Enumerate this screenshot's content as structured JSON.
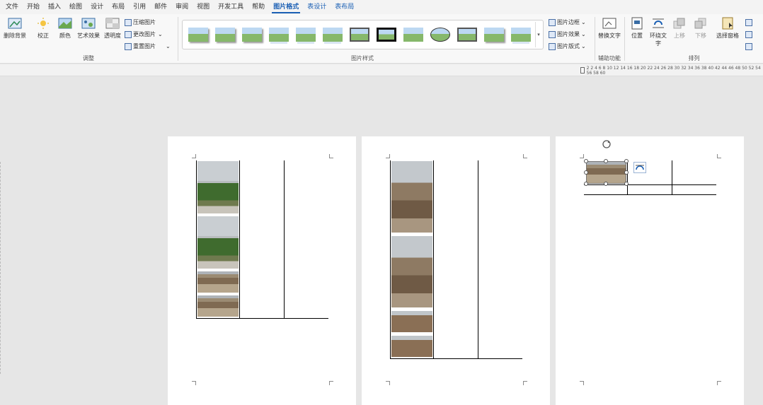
{
  "tabs": [
    "文件",
    "开始",
    "插入",
    "绘图",
    "设计",
    "布局",
    "引用",
    "邮件",
    "审阅",
    "视图",
    "开发工具",
    "帮助",
    "图片格式",
    "表设计",
    "表布局"
  ],
  "ribbon": {
    "adjust": {
      "remove_bg": "删除背景",
      "corrections": "校正",
      "color": "颜色",
      "artistic": "艺术效果",
      "transparency": "透明度",
      "compress": "压缩图片",
      "change": "更改图片",
      "reset": "重置图片",
      "label": "调整"
    },
    "styles_label": "图片样式",
    "border": "图片边框",
    "effects": "图片效果",
    "layout": "图片版式",
    "accessibility": {
      "alt_text": "替换文字",
      "label": "辅助功能"
    },
    "arrange": {
      "position": "位置",
      "wrap": "环绕文字",
      "forward": "上移",
      "backward": "下移",
      "selection_pane": "选择窗格",
      "label": "排列"
    }
  },
  "ruler": "2 2 4 6 8 10 12 14 16 18 20 22 24 26 28 30 32 34 36 38 40 42 44 46 48 50 52 54 56 58 60",
  "icons": {
    "rotate": "rotate-handle-icon",
    "layout_options": "layout-options-icon"
  },
  "colors": {
    "accent": "#1a5fb4",
    "page": "#ffffff",
    "canvas": "#e6e6e6"
  }
}
